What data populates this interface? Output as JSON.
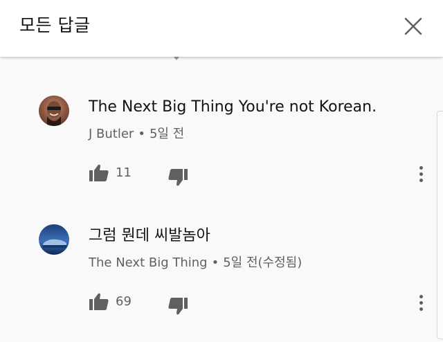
{
  "header": {
    "title": "모든 답글",
    "close_icon": "close-icon"
  },
  "comments": [
    {
      "text": "The Next Big Thing You're not Korean.",
      "author": "J Butler",
      "separator": "•",
      "time": "5일 전",
      "likes": "11",
      "avatar_icon": "user-avatar"
    },
    {
      "text": "그럼 뭔데 씨발놈아",
      "author": "The Next Big Thing",
      "separator": "•",
      "time": "5일 전(수정됨)",
      "likes": "69",
      "avatar_icon": "user-avatar"
    }
  ],
  "colors": {
    "background": "#f9f9f9",
    "header_bg": "#ffffff",
    "primary_text": "#121212",
    "secondary_text": "#606060"
  }
}
